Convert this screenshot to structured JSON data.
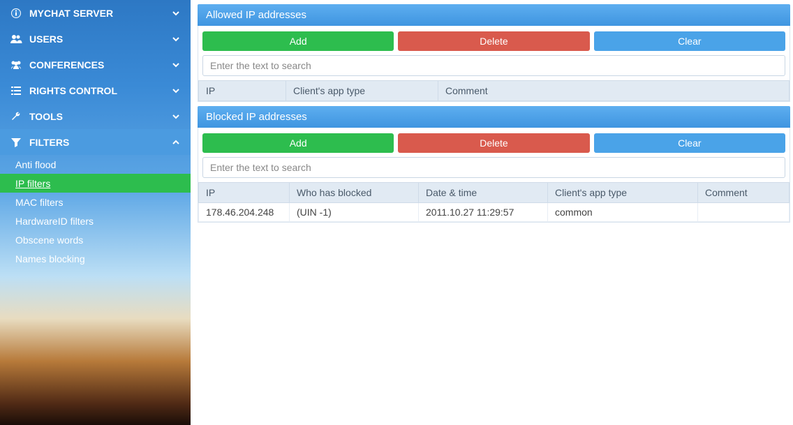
{
  "sidebar": {
    "items": [
      {
        "label": "MYCHAT SERVER"
      },
      {
        "label": "USERS"
      },
      {
        "label": "CONFERENCES"
      },
      {
        "label": "RIGHTS CONTROL"
      },
      {
        "label": "TOOLS"
      },
      {
        "label": "FILTERS"
      }
    ],
    "filters_sub": [
      {
        "label": "Anti flood"
      },
      {
        "label": "IP filters"
      },
      {
        "label": "MAC filters"
      },
      {
        "label": "HardwareID filters"
      },
      {
        "label": "Obscene words"
      },
      {
        "label": "Names blocking"
      }
    ]
  },
  "allowed": {
    "title": "Allowed IP addresses",
    "buttons": {
      "add": "Add",
      "delete": "Delete",
      "clear": "Clear"
    },
    "search_placeholder": "Enter the text to search",
    "columns": {
      "ip": "IP",
      "client_type": "Client's app type",
      "comment": "Comment"
    },
    "rows": []
  },
  "blocked": {
    "title": "Blocked IP addresses",
    "buttons": {
      "add": "Add",
      "delete": "Delete",
      "clear": "Clear"
    },
    "search_placeholder": "Enter the text to search",
    "columns": {
      "ip": "IP",
      "who": "Who has blocked",
      "datetime": "Date & time",
      "client_type": "Client's app type",
      "comment": "Comment"
    },
    "rows": [
      {
        "ip": "178.46.204.248",
        "who": "(UIN -1)",
        "datetime": "2011.10.27 11:29:57",
        "client_type": "common",
        "comment": ""
      }
    ]
  }
}
